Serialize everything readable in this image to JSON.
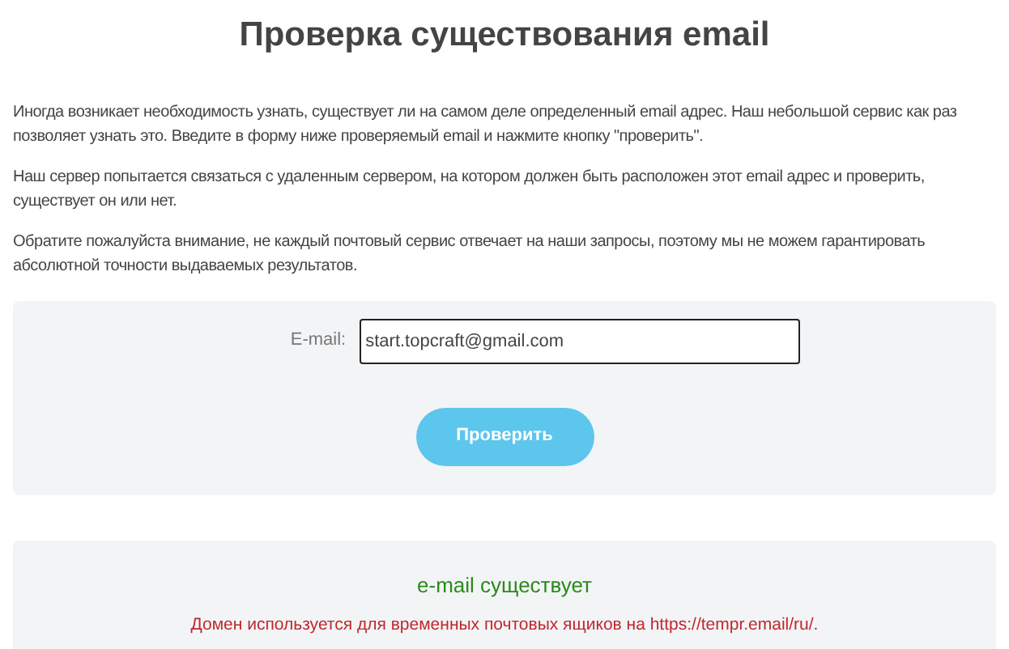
{
  "title": "Проверка существования email",
  "paragraphs": [
    "Иногда возникает необходимость узнать, существует ли на самом деле определенный email адрес. Наш небольшой сервис как раз позволяет узнать это. Введите в форму ниже проверяемый email и нажмите кнопку \"проверить\".",
    "Наш сервер попытается связаться с удаленным сервером, на котором должен быть расположен этот email адрес и проверить, существует он или нет.",
    "Обратите пожалуйста внимание, не каждый почтовый сервис отвечает на наши запросы, поэтому мы не можем гарантировать абсолютной точности выдаваемых результатов."
  ],
  "form": {
    "label": "E-mail:",
    "value": "start.topcraft@gmail.com",
    "button": "Проверить"
  },
  "result": [
    {
      "kind": "success",
      "text": "e-mail существует"
    },
    {
      "kind": "error",
      "text": "Домен используется для временных почтовых ящиков на https://tempr.email/ru/."
    }
  ]
}
